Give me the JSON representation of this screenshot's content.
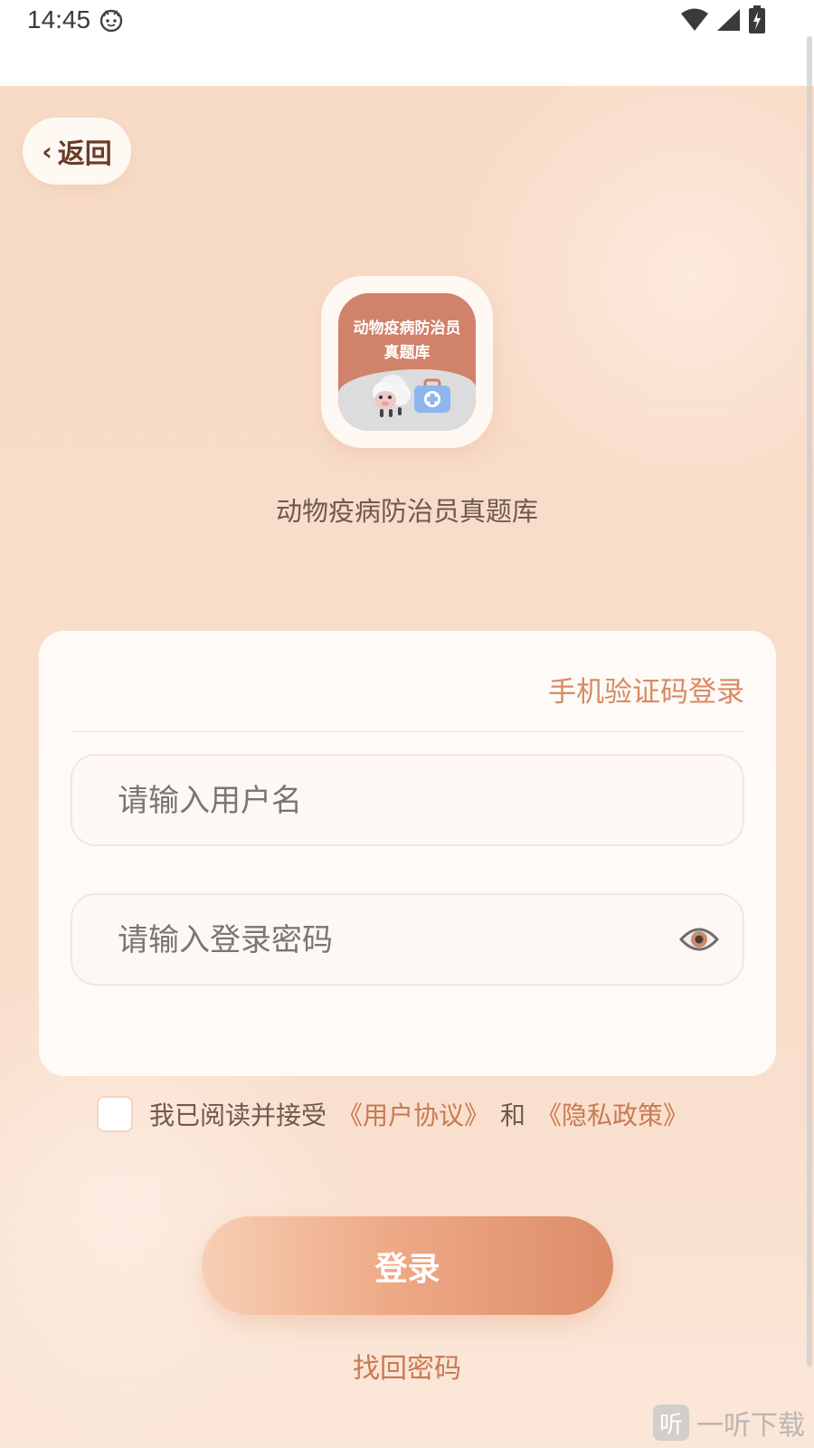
{
  "status_bar": {
    "time": "14:45",
    "icons": [
      "face-icon",
      "wifi-icon",
      "signal-icon",
      "battery-charging-icon"
    ]
  },
  "nav": {
    "back_label": "返回",
    "back_icon": "chevron-left-icon"
  },
  "app": {
    "logo_text_line1": "动物疫病防治员",
    "logo_text_line2": "真题库",
    "name": "动物疫病防治员真题库"
  },
  "login_card": {
    "sms_login_label": "手机验证码登录",
    "username_placeholder": "请输入用户名",
    "password_placeholder": "请输入登录密码",
    "password_visibility_icon": "eye-icon"
  },
  "agreement": {
    "prefix": "我已阅读并接受",
    "user_agreement": "《用户协议》",
    "and": "和",
    "privacy_policy": "《隐私政策》",
    "checked": false
  },
  "actions": {
    "login_label": "登录",
    "forgot_password_label": "找回密码"
  },
  "watermark": {
    "icon_char": "听",
    "text": "一听下载"
  },
  "colors": {
    "accent": "#d98a62",
    "link": "#c87a52",
    "back_text": "#6b3c27",
    "background": "#f9ddca"
  }
}
